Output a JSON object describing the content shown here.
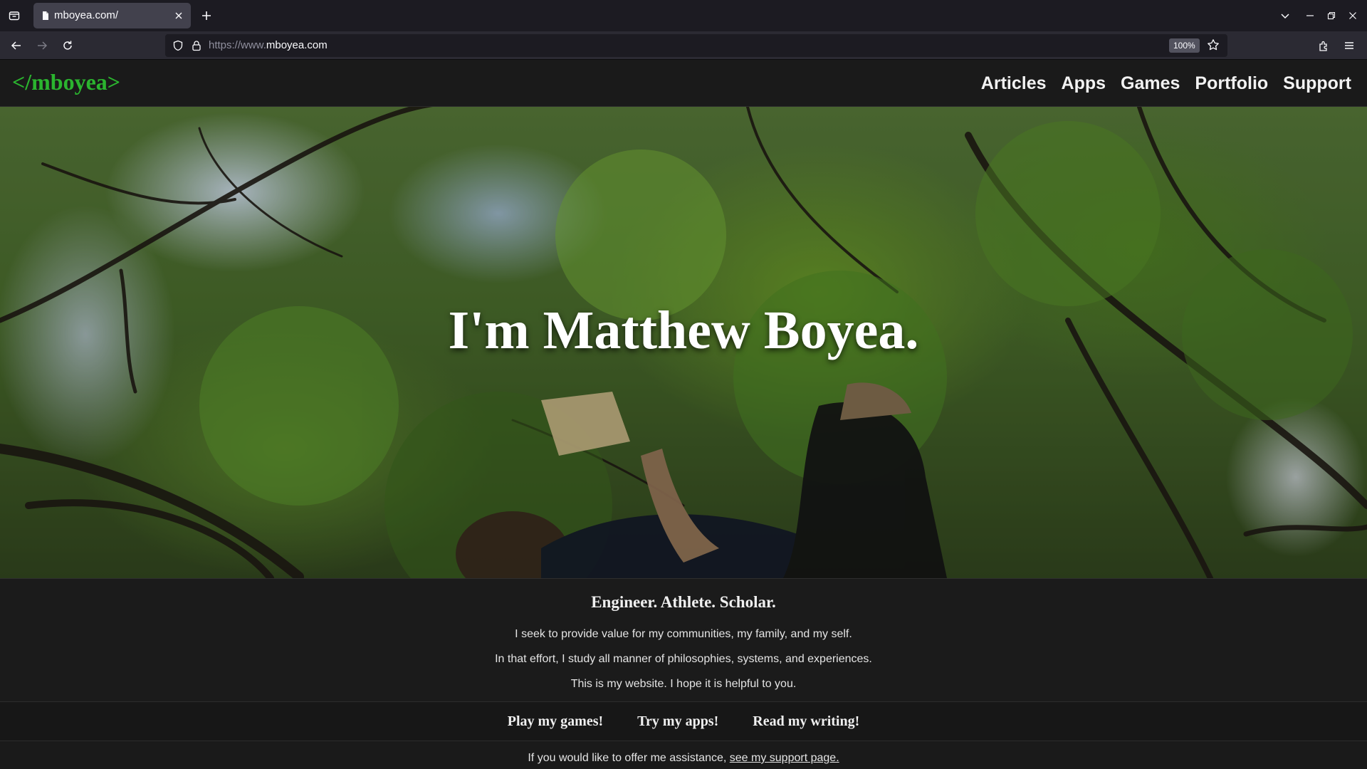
{
  "browser": {
    "tab_title": "mboyea.com/",
    "url_scheme": "https://www.",
    "url_host": "mboyea.com",
    "zoom": "100%"
  },
  "site": {
    "logo": "</mboyea>",
    "nav": [
      "Articles",
      "Apps",
      "Games",
      "Portfolio",
      "Support"
    ]
  },
  "hero": {
    "title": "I'm Matthew Boyea."
  },
  "intro": {
    "heading": "Engineer. Athlete. Scholar.",
    "lines": [
      "I seek to provide value for my communities, my family, and my self.",
      "In that effort, I study all manner of philosophies, systems, and experiences.",
      "This is my website. I hope it is helpful to you."
    ]
  },
  "cta": [
    "Play my games!",
    "Try my apps!",
    "Read my writing!"
  ],
  "support": {
    "text": "If you would like to offer me assistance, ",
    "link": "see my support page."
  },
  "colors": {
    "accent": "#2bb52f",
    "background": "#1a1a1a",
    "browser_toolbar": "#2b2a33"
  },
  "icons": [
    "tab-list-icon",
    "page-icon",
    "close-icon",
    "plus-icon",
    "chevron-down-icon",
    "minimize-icon",
    "restore-icon",
    "back-arrow-icon",
    "forward-arrow-icon",
    "reload-icon",
    "shield-icon",
    "lock-icon",
    "star-icon",
    "extensions-icon",
    "hamburger-menu-icon"
  ]
}
